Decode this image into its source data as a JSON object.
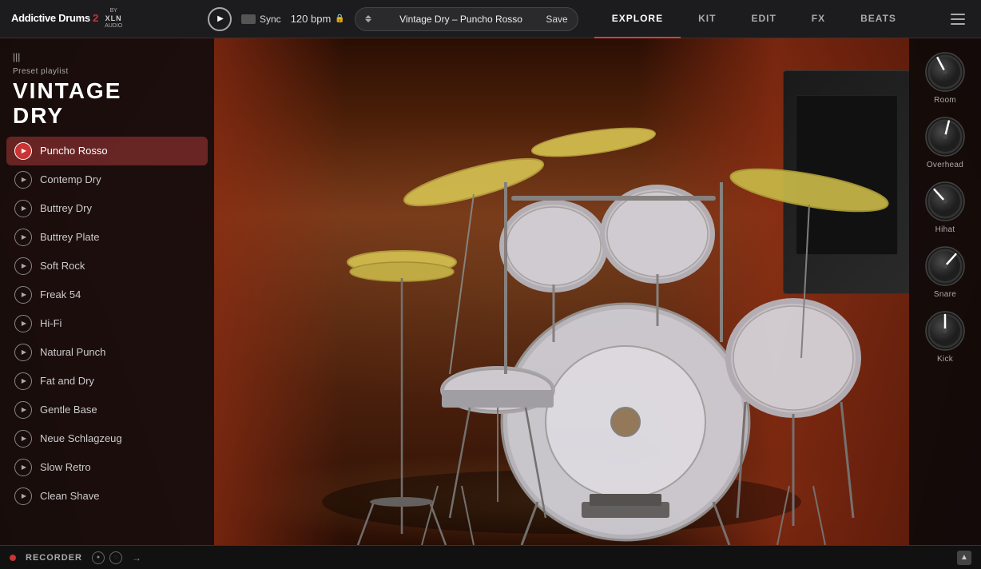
{
  "app": {
    "title": "Addictive Drums 2",
    "brand": "BY XLN AUDIO",
    "brand_by": "BY",
    "brand_xln": "XLN",
    "brand_audio": "AUDIO"
  },
  "topbar": {
    "play_label": "▶",
    "sync_label": "Sync",
    "bpm": "120 bpm",
    "lock_icon": "🔒",
    "preset_name": "Vintage Dry – Puncho Rosso",
    "save_label": "Save"
  },
  "nav": {
    "tabs": [
      {
        "id": "explore",
        "label": "EXPLORE",
        "active": true
      },
      {
        "id": "kit",
        "label": "KIT",
        "active": false
      },
      {
        "id": "edit",
        "label": "EDIT",
        "active": false
      },
      {
        "id": "fx",
        "label": "FX",
        "active": false
      },
      {
        "id": "beats",
        "label": "BEATS",
        "active": false
      }
    ]
  },
  "sidebar": {
    "playlist_icon": "|||",
    "preset_label": "Preset playlist",
    "title_line1": "VINTAGE",
    "title_line2": "DRY",
    "items": [
      {
        "id": 1,
        "label": "Puncho Rosso",
        "active": true
      },
      {
        "id": 2,
        "label": "Contemp Dry",
        "active": false
      },
      {
        "id": 3,
        "label": "Buttrey Dry",
        "active": false
      },
      {
        "id": 4,
        "label": "Buttrey Plate",
        "active": false
      },
      {
        "id": 5,
        "label": "Soft Rock",
        "active": false
      },
      {
        "id": 6,
        "label": "Freak 54",
        "active": false
      },
      {
        "id": 7,
        "label": "Hi-Fi",
        "active": false
      },
      {
        "id": 8,
        "label": "Natural Punch",
        "active": false
      },
      {
        "id": 9,
        "label": "Fat and Dry",
        "active": false
      },
      {
        "id": 10,
        "label": "Gentle Base",
        "active": false
      },
      {
        "id": 11,
        "label": "Neue Schlagzeug",
        "active": false
      },
      {
        "id": 12,
        "label": "Slow Retro",
        "active": false
      },
      {
        "id": 13,
        "label": "Clean Shave",
        "active": false
      }
    ]
  },
  "right_panel": {
    "knobs": [
      {
        "id": "room",
        "label": "Room",
        "value": 40,
        "angle": -60
      },
      {
        "id": "overhead",
        "label": "Overhead",
        "value": 55,
        "angle": -30
      },
      {
        "id": "hihat",
        "label": "Hihat",
        "value": 35,
        "angle": -70
      },
      {
        "id": "snare",
        "label": "Snare",
        "value": 65,
        "angle": -20
      },
      {
        "id": "kick",
        "label": "Kick",
        "value": 50,
        "angle": -45
      }
    ]
  },
  "bottombar": {
    "recorder_label": "RECORDER",
    "arrow": "→"
  },
  "colors": {
    "accent": "#cc3333",
    "active_tab_border": "#cc4444",
    "bg_dark": "#1c1c1e",
    "sidebar_bg": "rgba(20,12,12,0.92)"
  }
}
